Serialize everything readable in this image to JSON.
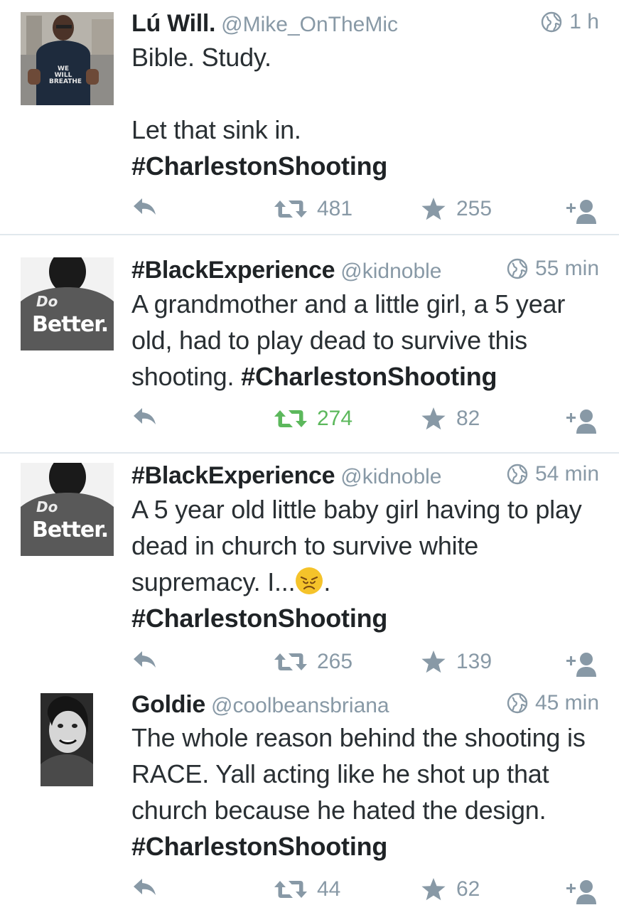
{
  "tweets": [
    {
      "name": "Lú Will.",
      "handle": "@Mike_OnTheMic",
      "time": "1 h",
      "text_plain": "Bible. Study.\n\nLet that sink in.\n",
      "hashtag": "#CharlestonShooting",
      "text_after": "",
      "retweets": "481",
      "favorites": "255",
      "retweeted": false,
      "avatar_text": [
        "WE",
        "WILL",
        "BREATHE"
      ]
    },
    {
      "name": "#BlackExperience",
      "handle": "@kidnoble",
      "time": "55 min",
      "text_plain": "A grandmother and a little girl, a 5 year old, had to play dead to survive this shooting. ",
      "hashtag": "#CharlestonShooting",
      "text_after": "",
      "retweets": "274",
      "favorites": "82",
      "retweeted": true,
      "avatar_text": [
        "Do",
        "Better."
      ]
    },
    {
      "name": "#BlackExperience",
      "handle": "@kidnoble",
      "time": "54 min",
      "text_plain": "A 5 year old little baby girl having to play dead in church to survive white supremacy. I...",
      "text_mid": ".\n",
      "hashtag": "#CharlestonShooting",
      "text_after": "",
      "retweets": "265",
      "favorites": "139",
      "retweeted": false,
      "avatar_text": [
        "Do",
        "Better."
      ]
    },
    {
      "name": "Goldie",
      "handle": "@coolbeansbriana",
      "time": "45 min",
      "text_plain": "The whole reason behind the shooting is RACE. Yall acting like he shot up that church because he hated the design. ",
      "hashtag": "#CharlestonShooting",
      "text_after": "",
      "retweets": "44",
      "favorites": "62",
      "retweeted": false
    }
  ],
  "icons": {
    "reply": "reply-icon",
    "retweet": "retweet-icon",
    "favorite": "star-icon",
    "follow": "follow-icon",
    "globe": "globe-icon",
    "emoji": "disappointed-face-emoji"
  },
  "colors": {
    "muted": "#8899a6",
    "text": "#292f33",
    "retweeted_green": "#5cb85c",
    "divider": "#e1e8ed"
  }
}
